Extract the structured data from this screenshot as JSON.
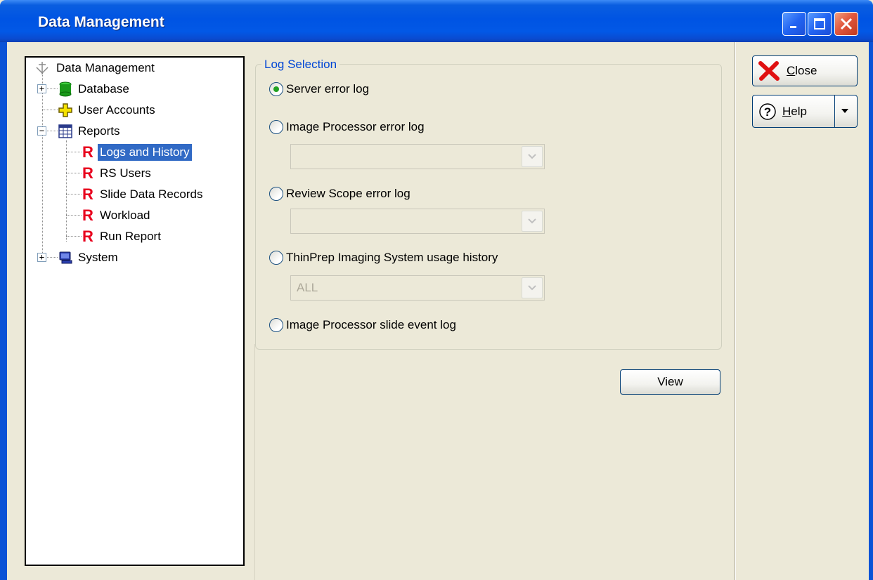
{
  "window": {
    "title": "Data Management"
  },
  "tree": {
    "root": "Data Management",
    "items": [
      {
        "label": "Database",
        "icon": "database-icon",
        "expander": "+"
      },
      {
        "label": "User Accounts",
        "icon": "user-accounts-icon"
      },
      {
        "label": "Reports",
        "icon": "reports-icon",
        "expander": "−",
        "children": [
          {
            "label": "Logs and History",
            "selected": true
          },
          {
            "label": "RS Users"
          },
          {
            "label": "Slide Data Records"
          },
          {
            "label": "Workload"
          },
          {
            "label": "Run Report"
          }
        ]
      },
      {
        "label": "System",
        "icon": "system-icon",
        "expander": "+"
      }
    ],
    "report_icon_glyph": "R"
  },
  "log_selection": {
    "title": "Log Selection",
    "options": [
      {
        "label": "Server error log",
        "checked": true
      },
      {
        "label": "Image Processor error log",
        "checked": false
      },
      {
        "label": "Review Scope error log",
        "checked": false
      },
      {
        "label": "ThinPrep Imaging System usage history",
        "checked": false
      },
      {
        "label": "Image Processor slide event log",
        "checked": false
      }
    ],
    "image_processor_select": "",
    "review_scope_select": "",
    "usage_history_select": "ALL"
  },
  "buttons": {
    "view": "View",
    "close_first": "C",
    "close_rest": "lose",
    "help_first": "H",
    "help_rest": "elp"
  },
  "colors": {
    "selection": "#316ac5",
    "report_icon": "#e8001e",
    "group_title": "#0046d5"
  }
}
